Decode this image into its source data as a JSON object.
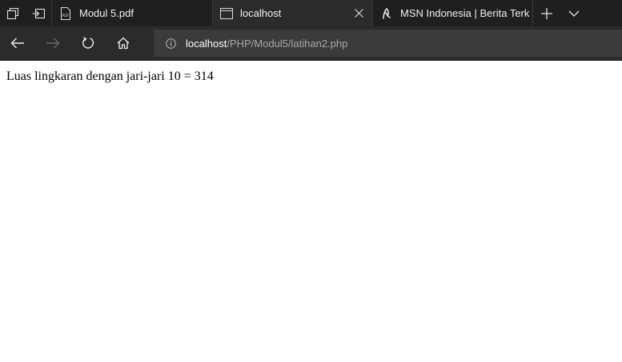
{
  "browser": {
    "tabs": [
      {
        "title": "Modul 5.pdf",
        "icon": "pdf-icon",
        "active": false
      },
      {
        "title": "localhost",
        "icon": "page-icon",
        "active": true
      },
      {
        "title": "MSN Indonesia | Berita Terk",
        "icon": "msn-icon",
        "active": false
      }
    ],
    "address": {
      "host": "localhost",
      "path": "/PHP/Modul5/latihan2.php"
    },
    "colors": {
      "tabbar_bg": "#1f1f1f",
      "toolbar_bg": "#2b2b2b",
      "address_bg": "#3b3b3b"
    }
  },
  "page": {
    "text": "Luas lingkaran dengan jari-jari 10 = 314"
  }
}
